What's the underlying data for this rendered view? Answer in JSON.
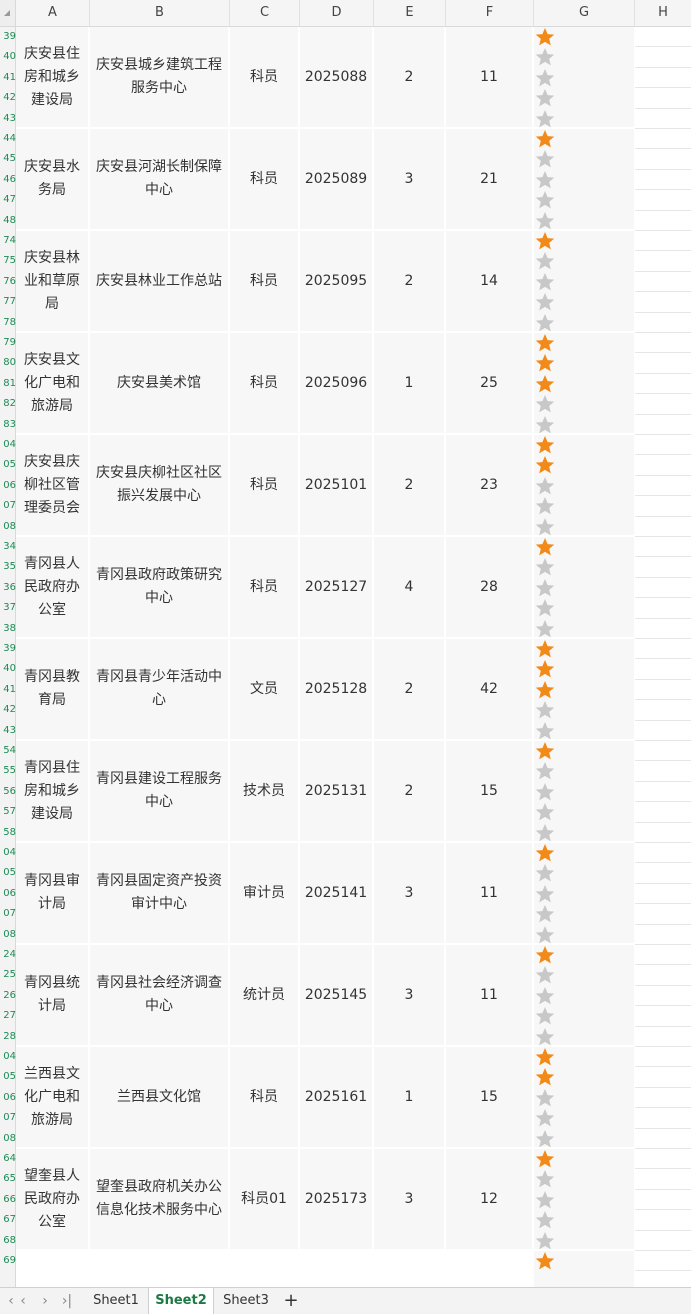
{
  "columns": [
    "A",
    "B",
    "C",
    "D",
    "E",
    "F",
    "G",
    "H"
  ],
  "row_numbers": [
    [
      "39",
      "40",
      "41",
      "42",
      "43"
    ],
    [
      "44",
      "45",
      "46",
      "47",
      "48"
    ],
    [
      "74",
      "75",
      "76",
      "77",
      "78"
    ],
    [
      "79",
      "80",
      "81",
      "82",
      "83"
    ],
    [
      "04",
      "05",
      "06",
      "07",
      "08"
    ],
    [
      "34",
      "35",
      "36",
      "37",
      "38"
    ],
    [
      "39",
      "40",
      "41",
      "42",
      "43"
    ],
    [
      "54",
      "55",
      "56",
      "57",
      "58"
    ],
    [
      "04",
      "05",
      "06",
      "07",
      "08"
    ],
    [
      "24",
      "25",
      "26",
      "27",
      "28"
    ],
    [
      "04",
      "05",
      "06",
      "07",
      "08"
    ],
    [
      "64",
      "65",
      "66",
      "67",
      "68"
    ],
    [
      "69"
    ]
  ],
  "rows": [
    {
      "a": "庆安县住房和城乡建设局",
      "b": "庆安县城乡建筑工程服务中心",
      "c": "科员",
      "d": "2025088",
      "e": "2",
      "f": "11",
      "rating": 1
    },
    {
      "a": "庆安县水务局",
      "b": "庆安县河湖长制保障中心",
      "c": "科员",
      "d": "2025089",
      "e": "3",
      "f": "21",
      "rating": 1
    },
    {
      "a": "庆安县林业和草原局",
      "b": "庆安县林业工作总站",
      "c": "科员",
      "d": "2025095",
      "e": "2",
      "f": "14",
      "rating": 1
    },
    {
      "a": "庆安县文化广电和旅游局",
      "b": "庆安县美术馆",
      "c": "科员",
      "d": "2025096",
      "e": "1",
      "f": "25",
      "rating": 3
    },
    {
      "a": "庆安县庆柳社区管理委员会",
      "b": "庆安县庆柳社区社区振兴发展中心",
      "c": "科员",
      "d": "2025101",
      "e": "2",
      "f": "23",
      "rating": 2
    },
    {
      "a": "青冈县人民政府办公室",
      "b": "青冈县政府政策研究中心",
      "c": "科员",
      "d": "2025127",
      "e": "4",
      "f": "28",
      "rating": 1
    },
    {
      "a": "青冈县教育局",
      "b": "青冈县青少年活动中心",
      "c": "文员",
      "d": "2025128",
      "e": "2",
      "f": "42",
      "rating": 3
    },
    {
      "a": "青冈县住房和城乡建设局",
      "b": "青冈县建设工程服务中心",
      "c": "技术员",
      "d": "2025131",
      "e": "2",
      "f": "15",
      "rating": 1
    },
    {
      "a": "青冈县审计局",
      "b": "青冈县固定资产投资审计中心",
      "c": "审计员",
      "d": "2025141",
      "e": "3",
      "f": "11",
      "rating": 1
    },
    {
      "a": "青冈县统计局",
      "b": "青冈县社会经济调查中心",
      "c": "统计员",
      "d": "2025145",
      "e": "3",
      "f": "11",
      "rating": 1
    },
    {
      "a": "兰西县文化广电和旅游局",
      "b": "兰西县文化馆",
      "c": "科员",
      "d": "2025161",
      "e": "1",
      "f": "15",
      "rating": 2
    },
    {
      "a": "望奎县人民政府办公室",
      "b": "望奎县政府机关办公信息化技术服务中心",
      "c": "科员01",
      "d": "2025173",
      "e": "3",
      "f": "12",
      "rating": 1
    }
  ],
  "partial_row": {
    "rating": 1
  },
  "colors": {
    "star_filled": "#f28a1a",
    "star_empty": "#c8c8c8",
    "active_tab": "#1e7a45",
    "row_number": "#1e8a55"
  },
  "icons": {
    "prev_first": "chevron-double-left-icon",
    "prev": "chevron-left-icon",
    "next": "chevron-right-icon",
    "next_last": "chevron-double-right-icon",
    "add": "plus-icon",
    "rating": "star-icon"
  },
  "tabs": [
    {
      "label": "Sheet1",
      "active": false
    },
    {
      "label": "Sheet2",
      "active": true
    },
    {
      "label": "Sheet3",
      "active": false
    }
  ],
  "nav": {
    "first": "‹",
    "prev": "‹",
    "next": "›",
    "last": "›|",
    "add": "+"
  }
}
